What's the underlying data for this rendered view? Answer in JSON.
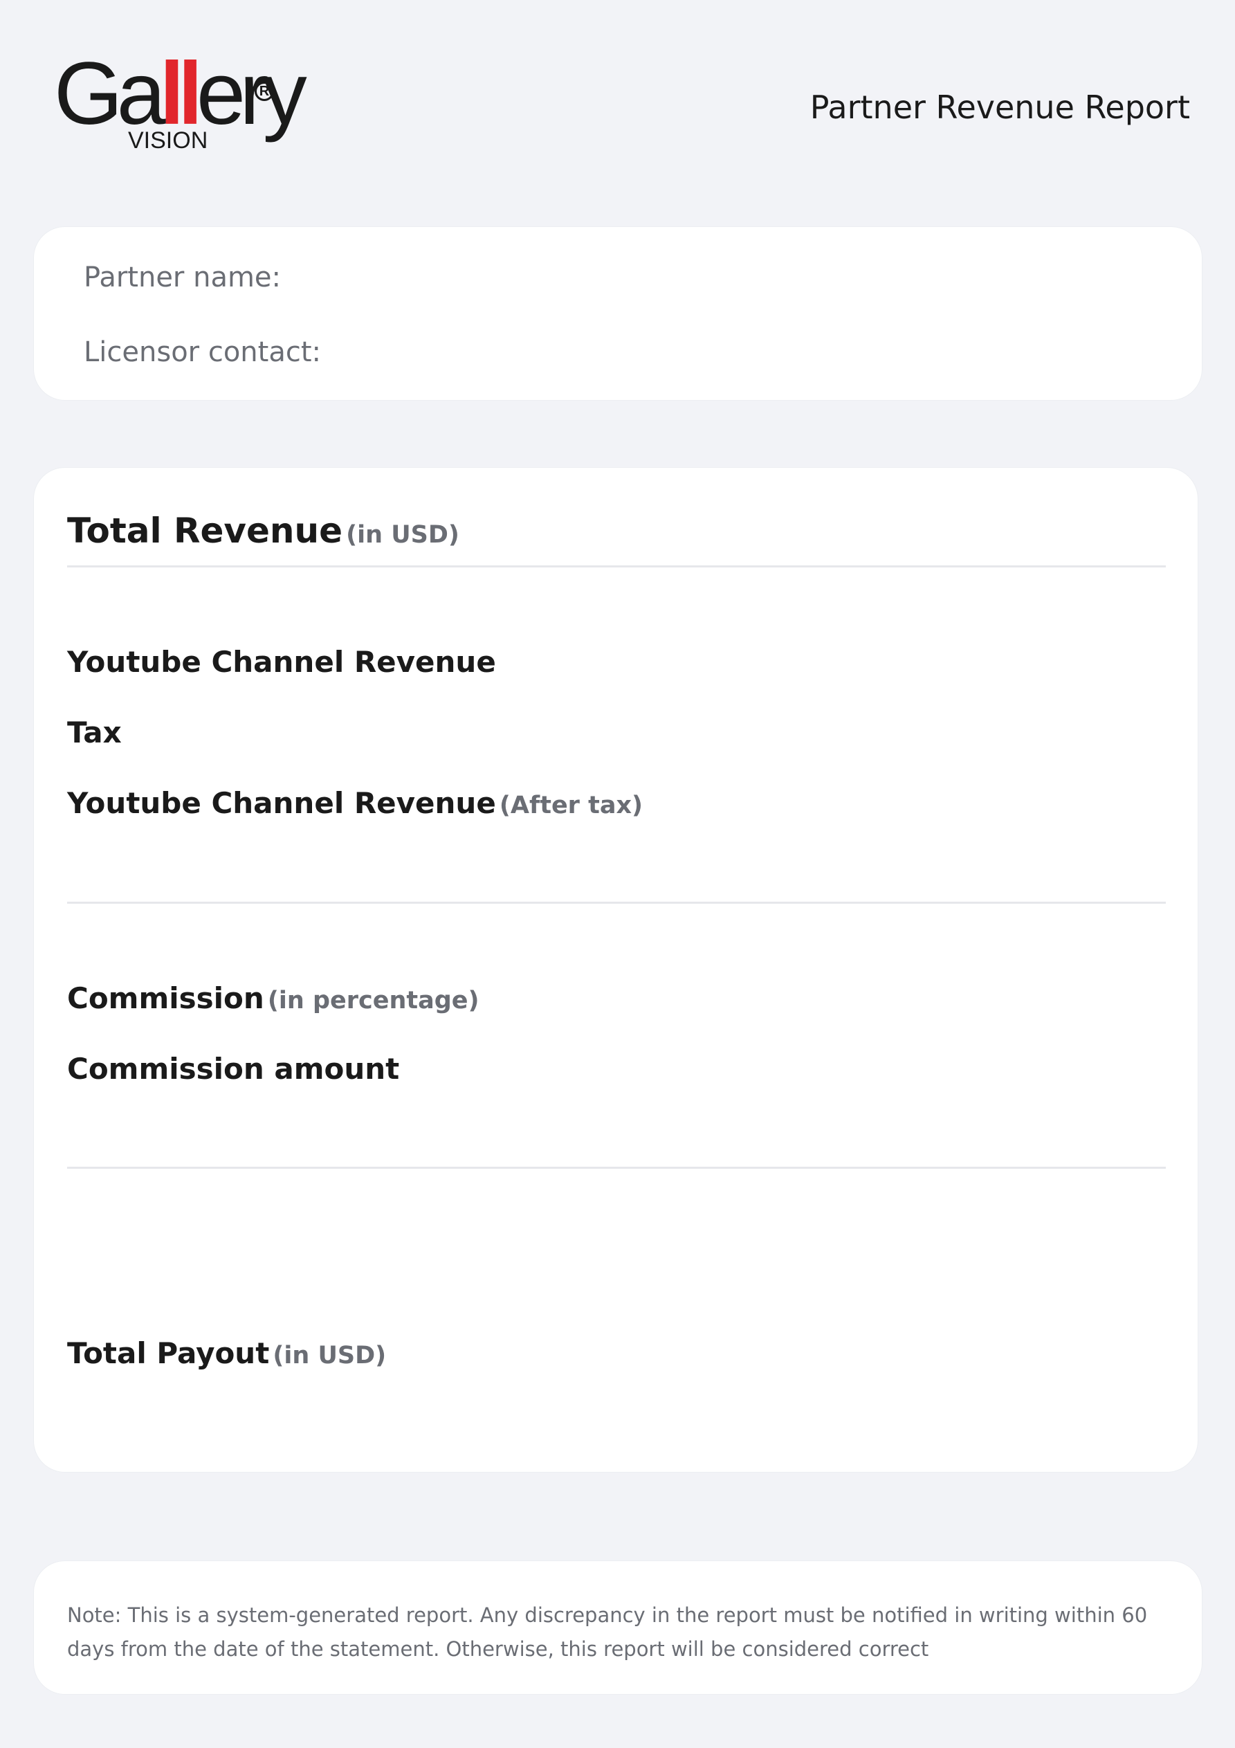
{
  "logo": {
    "word_start": "Ga",
    "word_accent": "ll",
    "word_end": "ery",
    "registered": "R",
    "sub": "VISION"
  },
  "header": {
    "title": "Partner Revenue Report"
  },
  "partner_card": {
    "partner_name_label": "Partner name:",
    "licensor_contact_label": "Licensor contact:"
  },
  "revenue_card": {
    "title": "Total Revenue",
    "title_unit": "(in USD)",
    "youtube_revenue": "Youtube Channel Revenue",
    "tax": "Tax",
    "youtube_after_tax": "Youtube Channel Revenue",
    "youtube_after_tax_unit": "(After tax)",
    "commission": "Commission",
    "commission_unit": "(in percentage)",
    "commission_amount": "Commission amount",
    "total_payout": "Total Payout",
    "total_payout_unit": "(in USD)"
  },
  "note": {
    "text": "Note: This is a system-generated report. Any discrepancy in the report must be notified in writing within 60 days from the date of the statement. Otherwise, this report will be considered correct"
  },
  "colors": {
    "background": "#f2f3f7",
    "card": "#ffffff",
    "text_primary": "#1a1a1a",
    "text_muted": "#6a6d74",
    "brand_accent": "#e1262c",
    "divider": "#e6e7eb"
  }
}
